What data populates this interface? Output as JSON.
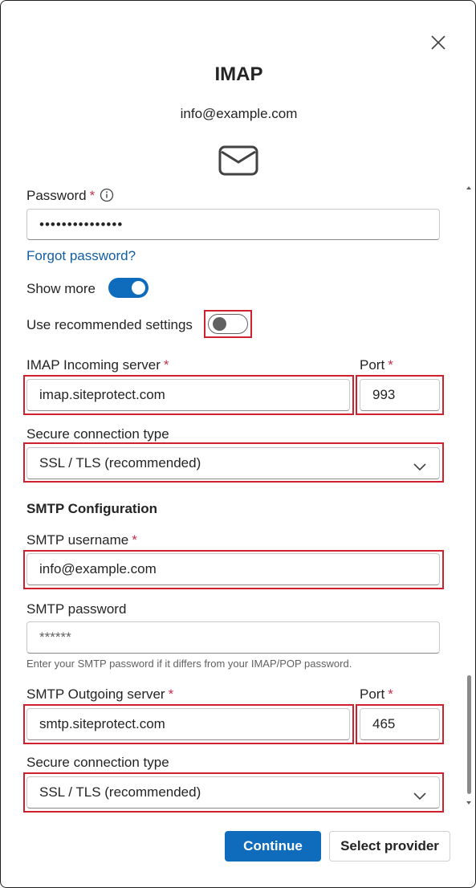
{
  "dialog": {
    "title": "IMAP",
    "account_email": "info@example.com"
  },
  "icons": {
    "close": "close-icon",
    "mail": "mail-icon",
    "info": "info-icon",
    "chevron": "chevron-down-icon"
  },
  "password": {
    "label": "Password",
    "required_mark": "*",
    "value": "•••••••••••••••"
  },
  "forgot_password_link": "Forgot password?",
  "show_more": {
    "label": "Show more",
    "on": true
  },
  "use_recommended": {
    "label": "Use recommended settings",
    "on": false
  },
  "imap": {
    "server_label": "IMAP Incoming server",
    "server_value": "imap.siteprotect.com",
    "port_label": "Port",
    "port_value": "993",
    "secure_label": "Secure connection type",
    "secure_value": "SSL / TLS (recommended)"
  },
  "smtp": {
    "section_title": "SMTP Configuration",
    "username_label": "SMTP username",
    "username_value": "info@example.com",
    "password_label": "SMTP password",
    "password_placeholder": "******",
    "password_hint": "Enter your SMTP password if it differs from your IMAP/POP password.",
    "server_label": "SMTP Outgoing server",
    "server_value": "smtp.siteprotect.com",
    "port_label": "Port",
    "port_value": "465",
    "secure_label": "Secure connection type",
    "secure_value": "SSL / TLS (recommended)"
  },
  "buttons": {
    "continue": "Continue",
    "select_provider": "Select provider"
  },
  "colors": {
    "accent": "#0f6cbd",
    "required": "#c4314b",
    "highlight": "#d0202e",
    "link": "#115ea3"
  }
}
